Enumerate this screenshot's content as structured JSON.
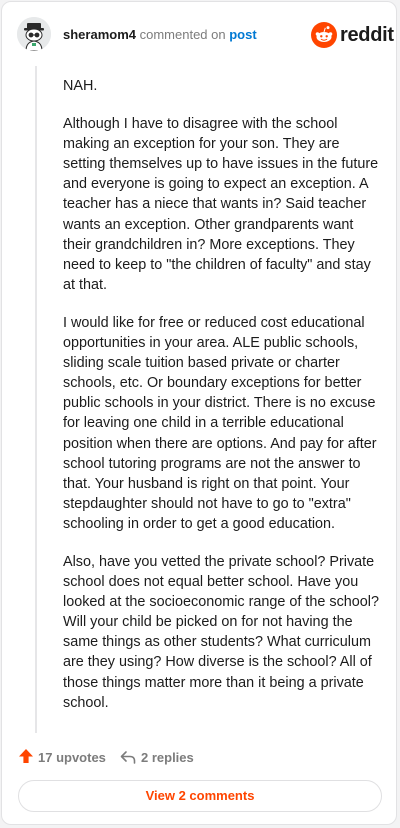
{
  "header": {
    "username": "sheramom4",
    "commented_text": "commented on",
    "post_link": "post",
    "logo_text": "reddit",
    "avatar_icon": "snoo-avatar-icon",
    "logo_icon": "reddit-logo-icon"
  },
  "comment": {
    "paragraphs": [
      "NAH.",
      "Although I have to disagree with the school making an exception for your son. They are setting themselves up to have issues in the future and everyone is going to expect an exception. A teacher has a niece that wants in? Said teacher wants an exception. Other grandparents want their grandchildren in? More exceptions. They need to keep to \"the children of faculty\" and stay at that.",
      "I would like for free or reduced cost educational opportunities in your area. ALE public schools, sliding scale tuition based private or charter schools, etc. Or boundary exceptions for better public schools in your district. There is no excuse for leaving one child in a terrible educational position when there are options. And pay for after school tutoring programs are not the answer to that. Your husband is right on that point. Your stepdaughter should not have to go to \"extra\" schooling in order to get a good education.",
      "Also, have you vetted the private school? Private school does not equal better school. Have you looked at the socioeconomic range of the school? Will your child be picked on for not having the same things as other students? What curriculum are they using? How diverse is the school? All of those things matter more than it being a private school."
    ]
  },
  "actions": {
    "upvotes": "17 upvotes",
    "replies": "2 replies",
    "upvote_icon": "upvote-arrow-icon",
    "reply_icon": "reply-arrow-icon"
  },
  "view_comments": "View 2 comments",
  "colors": {
    "brand": "#ff4500",
    "link": "#0079d3",
    "text": "#1c1c1c",
    "muted": "#7c7c7c"
  }
}
